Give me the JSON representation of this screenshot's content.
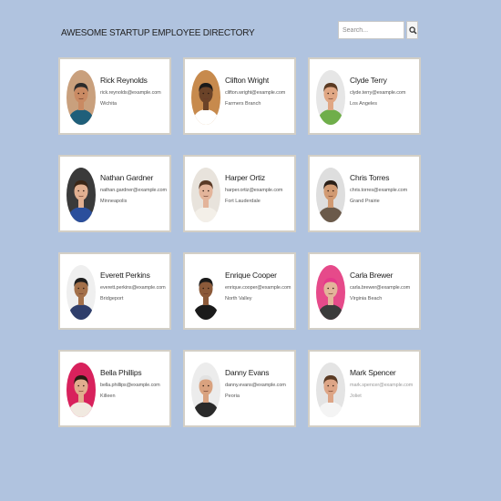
{
  "header": {
    "title": "AWESOME STARTUP EMPLOYEE DIRECTORY",
    "search_placeholder": "Search...",
    "search_icon": "magnifier-icon"
  },
  "employees": [
    {
      "name": "Rick Reynolds",
      "email": "rick.reynolds@example.com",
      "city": "Wichita",
      "bg": "#c9a07d",
      "skin": "#c98a63",
      "hair": "#2b2b2b",
      "shirt": "#1f5f7a"
    },
    {
      "name": "Clifton Wright",
      "email": "clifton.wright@example.com",
      "city": "Farmers Branch",
      "bg": "#c78a4d",
      "skin": "#6b4328",
      "hair": "#1a1a1a",
      "shirt": "#ffffff"
    },
    {
      "name": "Clyde Terry",
      "email": "clyde.terry@example.com",
      "city": "Los Angeles",
      "bg": "#e6e6e6",
      "skin": "#e0a784",
      "hair": "#5a3a22",
      "shirt": "#6fae4a"
    },
    {
      "name": "Nathan Gardner",
      "email": "nathan.gardner@example.com",
      "city": "Minneapolis",
      "bg": "#3a3a3a",
      "skin": "#e2b091",
      "hair": "#3b2616",
      "shirt": "#2b4f9c"
    },
    {
      "name": "Harper Ortiz",
      "email": "harper.ortiz@example.com",
      "city": "Fort Lauderdale",
      "bg": "#e8e3dc",
      "skin": "#e3b49a",
      "hair": "#5a3a26",
      "shirt": "#f3efe8"
    },
    {
      "name": "Chris Torres",
      "email": "chris.torres@example.com",
      "city": "Grand Prairie",
      "bg": "#dedede",
      "skin": "#d19a72",
      "hair": "#2a1f17",
      "shirt": "#6b5a4a"
    },
    {
      "name": "Everett Perkins",
      "email": "everett.perkins@example.com",
      "city": "Bridgeport",
      "bg": "#efefef",
      "skin": "#a3704a",
      "hair": "#1d1d1d",
      "shirt": "#2f3e6b"
    },
    {
      "name": "Enrique Cooper",
      "email": "enrique.cooper@example.com",
      "city": "North Valley",
      "bg": "#ffffff",
      "skin": "#8b5a3a",
      "hair": "#1a1a1a",
      "shirt": "#1a1a1a"
    },
    {
      "name": "Carla Brewer",
      "email": "carla.brewer@example.com",
      "city": "Virginia Beach",
      "bg": "#e64a8a",
      "skin": "#e3b49a",
      "hair": "#e5398a",
      "shirt": "#3b3b3b"
    },
    {
      "name": "Bella Phillips",
      "email": "bella.phillips@example.com",
      "city": "Killeen",
      "bg": "#d8215c",
      "skin": "#e1ad8e",
      "hair": "#2a1a12",
      "shirt": "#f1e9e0"
    },
    {
      "name": "Danny Evans",
      "email": "danny.evans@example.com",
      "city": "Peoria",
      "bg": "#ececec",
      "skin": "#d9a27f",
      "hair": "#e2e2e2",
      "shirt": "#2a2a2a"
    },
    {
      "name": "Mark Spencer",
      "email": "mark.spencer@example.com",
      "city": "Joliet",
      "bg": "#e4e4e4",
      "skin": "#dda586",
      "hair": "#5a3a24",
      "shirt": "#f4f4f4",
      "muted": true
    }
  ]
}
